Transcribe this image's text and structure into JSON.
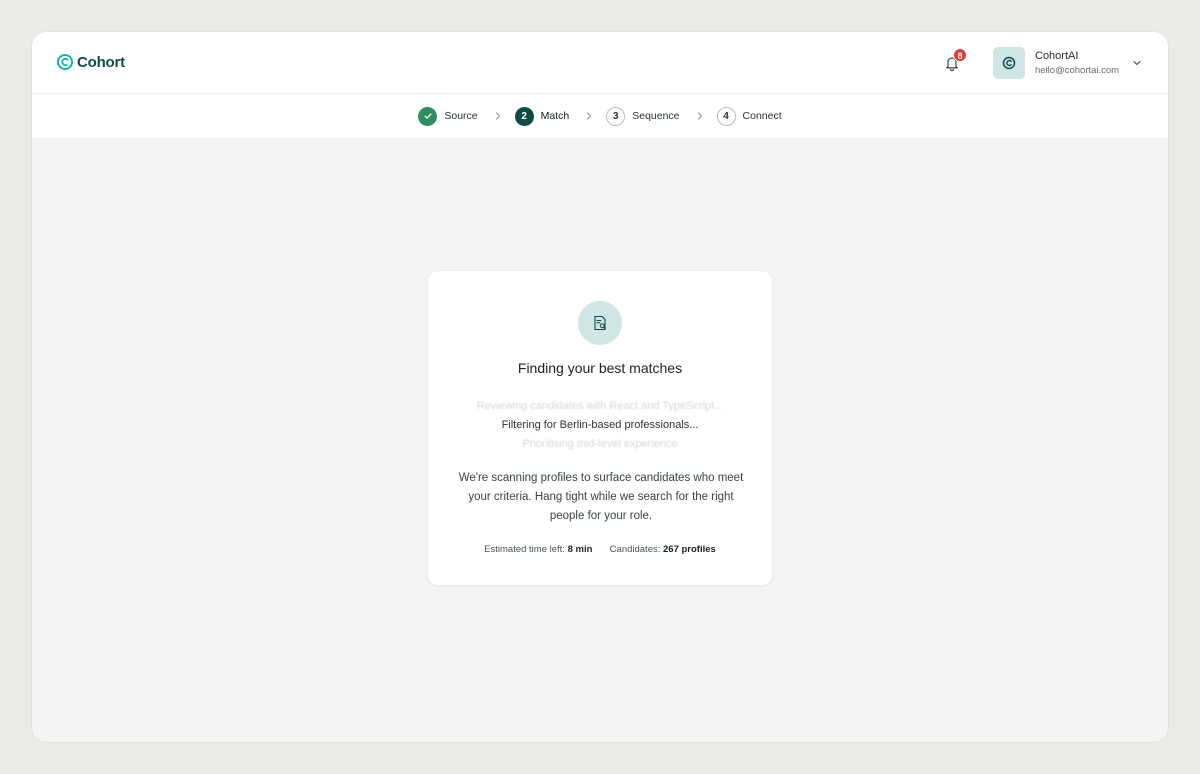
{
  "brand": {
    "name": "Cohort",
    "accent": "#0F4A46",
    "teal_light": "#CFE6E5"
  },
  "header": {
    "notifications": {
      "count": "8"
    },
    "account": {
      "name": "CohortAI",
      "email": "hello@cohortai.com"
    }
  },
  "stepper": {
    "steps": [
      {
        "number": "",
        "label": "Source",
        "state": "done"
      },
      {
        "number": "2",
        "label": "Match",
        "state": "active"
      },
      {
        "number": "3",
        "label": "Sequence",
        "state": "pending"
      },
      {
        "number": "4",
        "label": "Connect",
        "state": "pending"
      }
    ]
  },
  "card": {
    "title": "Finding your best matches",
    "ticker": {
      "previous": "Reviewing candidates with React and TypeScript...",
      "current": "Filtering for Berlin-based professionals...",
      "next": "Prioritising mid-level experience"
    },
    "description": "We're scanning profiles to surface candidates who meet your criteria. Hang tight while we search for the right people for your role.",
    "meta": {
      "time_label": "Estimated time left:",
      "time_value": "8 min",
      "candidates_label": "Candidates:",
      "candidates_value": "267 profiles"
    }
  }
}
